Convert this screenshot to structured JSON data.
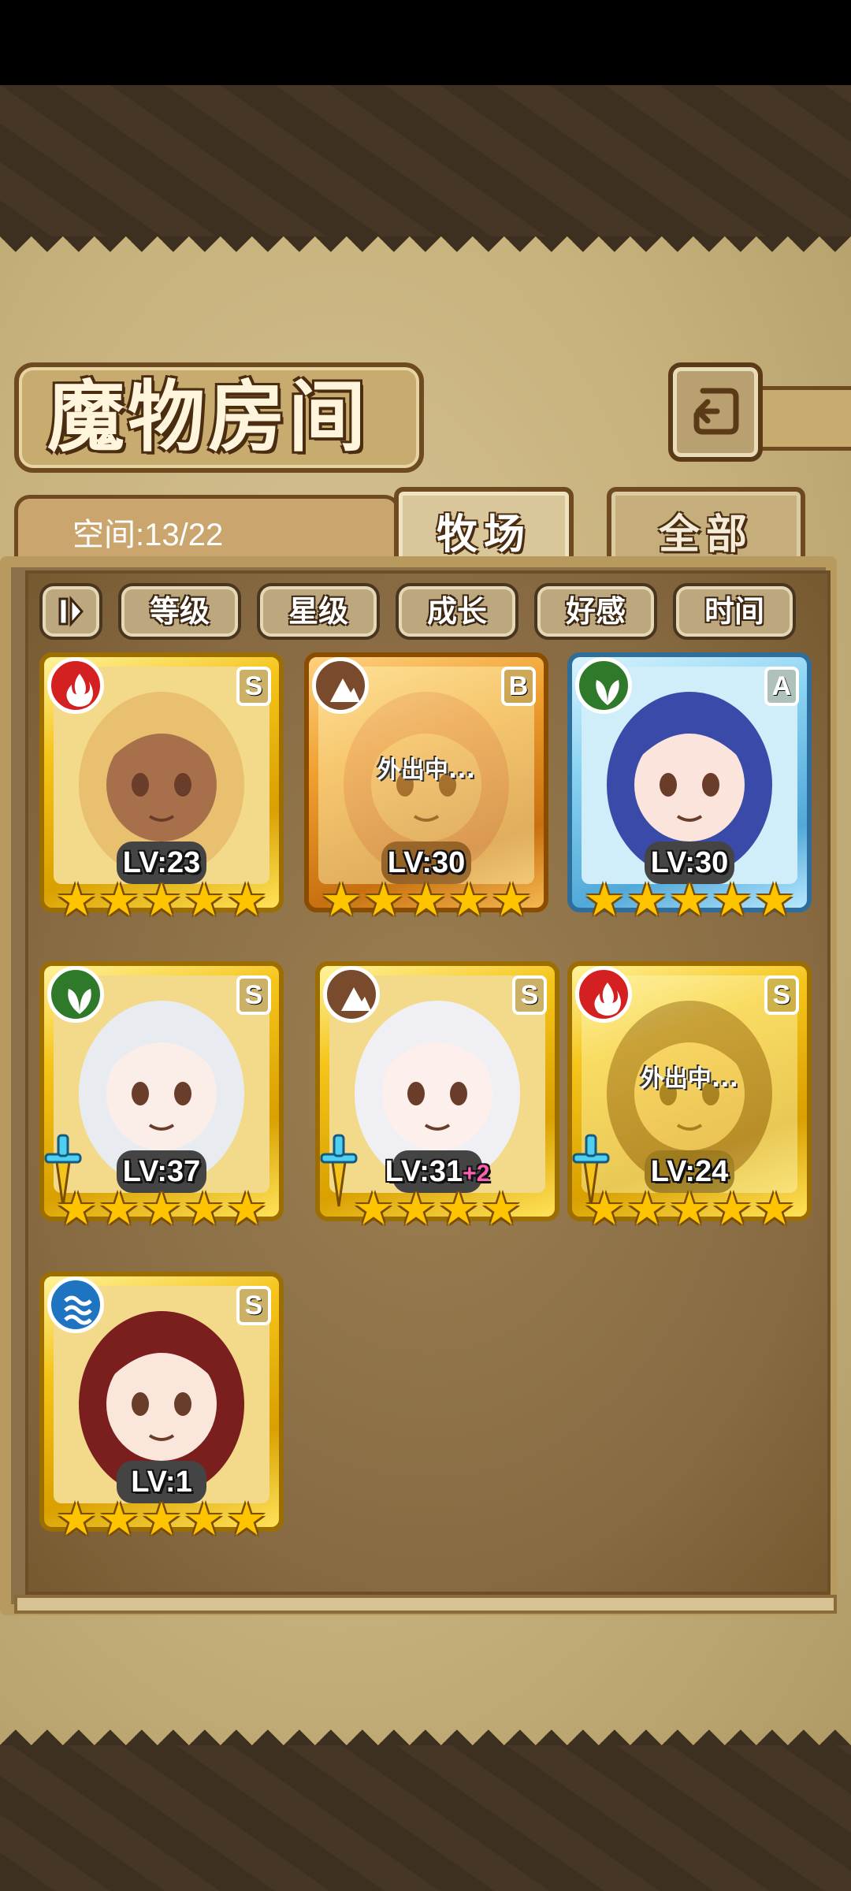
{
  "screen": {
    "title": "魔物房间",
    "space_text": "空间:13/22",
    "tabs": [
      {
        "label": "牧场",
        "active": true
      },
      {
        "label": "全部",
        "active": false
      }
    ],
    "sort_buttons": [
      "等级",
      "星级",
      "成长",
      "好感",
      "时间"
    ]
  },
  "cards": [
    {
      "element": "fire",
      "rank": "S",
      "frame": "gold",
      "level_text": "LV:23",
      "stars": "★★★★★",
      "away_text": "",
      "plus_text": "",
      "has_sword": false
    },
    {
      "element": "earth",
      "rank": "B",
      "frame": "orange",
      "level_text": "LV:30",
      "stars": "★★★★★",
      "away_text": "外出中...",
      "plus_text": "",
      "has_sword": false
    },
    {
      "element": "wood",
      "rank": "A",
      "frame": "blue",
      "level_text": "LV:30",
      "stars": "★★★★★",
      "away_text": "",
      "plus_text": "",
      "has_sword": false
    },
    {
      "element": "wood",
      "rank": "S",
      "frame": "gold",
      "level_text": "LV:37",
      "stars": "★★★★★",
      "away_text": "",
      "plus_text": "",
      "has_sword": true
    },
    {
      "element": "earth",
      "rank": "S",
      "frame": "gold",
      "level_text": "LV:31",
      "stars": "★★★★",
      "away_text": "",
      "plus_text": "+2",
      "has_sword": true
    },
    {
      "element": "fire",
      "rank": "S",
      "frame": "gold",
      "level_text": "LV:24",
      "stars": "★★★★★",
      "away_text": "外出中...",
      "plus_text": "",
      "has_sword": true
    },
    {
      "element": "water",
      "rank": "S",
      "frame": "gold",
      "level_text": "LV:1",
      "stars": "★★★★★",
      "away_text": "",
      "plus_text": "",
      "has_sword": false
    }
  ],
  "icons": {
    "back": "back-arrow-icon",
    "toggle": "pause-toggle-icon"
  }
}
